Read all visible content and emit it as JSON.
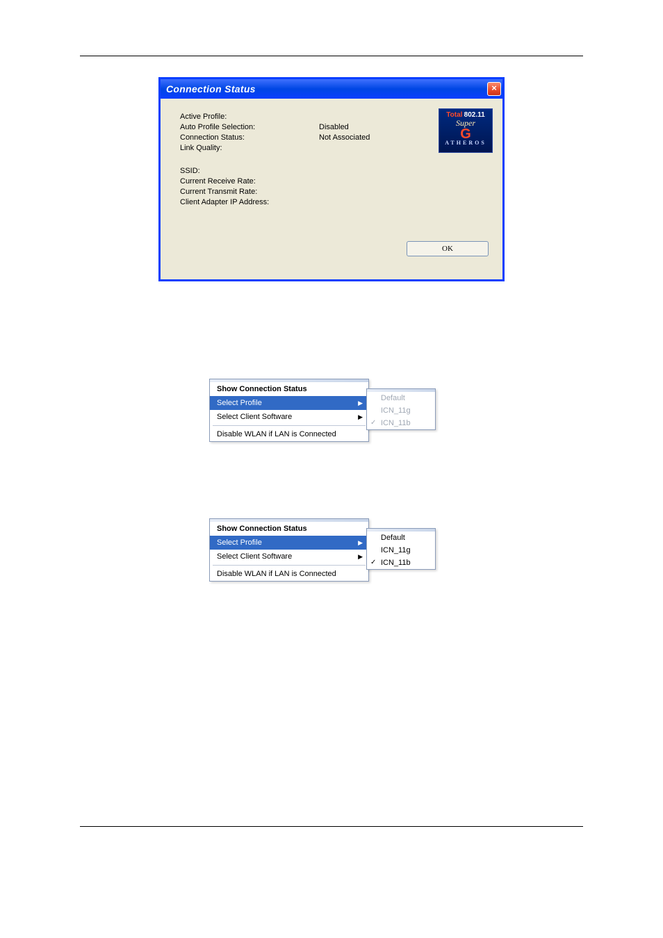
{
  "dialog": {
    "title": "Connection Status",
    "close_glyph": "×",
    "labels": {
      "active_profile": "Active Profile:",
      "auto_profile": "Auto Profile Selection:",
      "conn_status": "Connection Status:",
      "link_quality": "Link Quality:",
      "ssid": "SSID:",
      "rx_rate": "Current Receive Rate:",
      "tx_rate": "Current Transmit Rate:",
      "ip_addr": "Client Adapter IP Address:"
    },
    "values": {
      "active_profile": "",
      "auto_profile": "Disabled",
      "conn_status": "Not Associated",
      "link_quality": "",
      "ssid": "",
      "rx_rate": "",
      "tx_rate": "",
      "ip_addr": ""
    },
    "logo": {
      "line1a": "Total",
      "line1b": "802.11",
      "line2": "Super",
      "line3": "G",
      "line4": "ATHEROS"
    },
    "ok_label": "OK"
  },
  "menu1": {
    "show_status": "Show Connection Status",
    "select_profile": "Select Profile",
    "select_client": "Select Client Software",
    "disable_wlan": "Disable WLAN if LAN is Connected",
    "arrow": "▶",
    "submenu": {
      "default": "Default",
      "icn11g": "ICN_11g",
      "icn11b": "ICN_11b",
      "check": "✓",
      "checked_index": 2,
      "all_dim": true
    }
  },
  "menu2": {
    "show_status": "Show Connection Status",
    "select_profile": "Select Profile",
    "select_client": "Select Client Software",
    "disable_wlan": "Disable WLAN if LAN is Connected",
    "arrow": "▶",
    "submenu": {
      "default": "Default",
      "icn11g": "ICN_11g",
      "icn11b": "ICN_11b",
      "check": "✓",
      "checked_index": 2,
      "all_dim": false
    }
  }
}
